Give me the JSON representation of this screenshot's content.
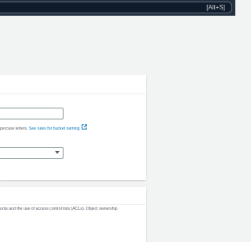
{
  "top_bar": {
    "search_shortcut": "[Alt+S]"
  },
  "general_config": {
    "bucket_name": {
      "value": "",
      "hint_prefix": "percase letters. ",
      "hint_link": "See rules for bucket naming",
      "hint_link_icon": "external-link-icon"
    },
    "region": {
      "selected": ""
    }
  },
  "object_ownership": {
    "description": "unts and the use of access control lists (ACLs). Object ownership"
  },
  "colors": {
    "top_bar": "#232f3e",
    "background": "#f2f3f3",
    "link": "#0073bb"
  }
}
